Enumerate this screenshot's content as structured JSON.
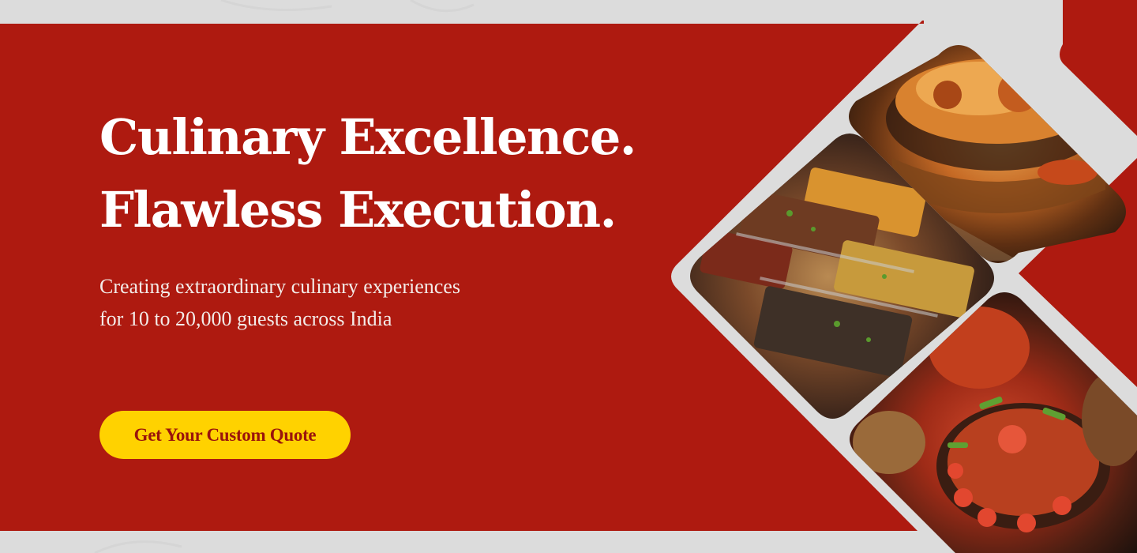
{
  "colors": {
    "background": "#dcdcdc",
    "hero_red": "#ae1a10",
    "cta_yellow": "#ffd200",
    "cta_text": "#9a140c",
    "text_white": "#ffffff"
  },
  "hero": {
    "headline_line1": "Culinary Excellence.",
    "headline_line2": "Flawless Execution.",
    "subtext_line1": "Creating extraordinary culinary experiences",
    "subtext_line2": "for 10 to 20,000 guests across India",
    "cta_label": "Get Your Custom Quote"
  },
  "gallery": {
    "tiles": [
      {
        "name": "biryani-bowl-photo"
      },
      {
        "name": "buffet-trays-photo"
      },
      {
        "name": "chilli-chicken-platter-photo"
      }
    ]
  }
}
